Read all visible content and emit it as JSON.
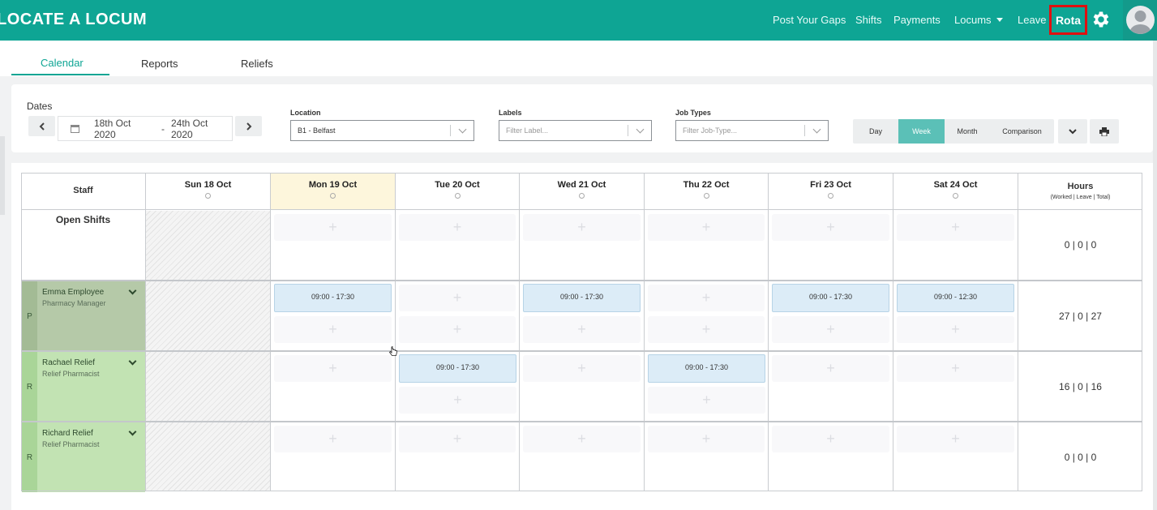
{
  "brand": "LOCATE A LOCUM",
  "nav": {
    "post_gaps": "Post Your Gaps",
    "shifts": "Shifts",
    "payments": "Payments",
    "locums": "Locums",
    "leave": "Leave",
    "rota": "Rota"
  },
  "tabs": [
    "Calendar",
    "Reports",
    "Reliefs"
  ],
  "filters": {
    "dates_label": "Dates",
    "date_start": "18th Oct 2020",
    "date_sep": "-",
    "date_end": "24th Oct 2020",
    "location_label": "Location",
    "location_value": "B1 - Belfast",
    "labels_label": "Labels",
    "labels_placeholder": "Filter Label...",
    "job_types_label": "Job Types",
    "job_types_placeholder": "Filter Job-Type..."
  },
  "views": [
    "Day",
    "Week",
    "Month",
    "Comparison"
  ],
  "active_view": "Week",
  "grid": {
    "staff_header": "Staff",
    "hours_header": "Hours",
    "hours_sub": "(Worked | Leave | Total)",
    "days": [
      "Sun 18 Oct",
      "Mon 19 Oct",
      "Tue 20 Oct",
      "Wed 21 Oct",
      "Thu 22 Oct",
      "Fri 23 Oct",
      "Sat 24 Oct"
    ],
    "open_shifts_label": "Open Shifts",
    "open_shifts_hours": "0 | 0 | 0",
    "staff": [
      {
        "tag": "P",
        "name": "Emma Employee",
        "role": "Pharmacy Manager",
        "hours": "27 | 0 | 27",
        "shifts": [
          "",
          "09:00 - 17:30",
          "",
          "09:00 - 17:30",
          "",
          "09:00 - 17:30",
          "09:00 - 12:30"
        ]
      },
      {
        "tag": "R",
        "name": "Rachael Relief",
        "role": "Relief Pharmacist",
        "hours": "16 | 0 | 16",
        "shifts": [
          "",
          "",
          "09:00 - 17:30",
          "",
          "09:00 - 17:30",
          "",
          ""
        ]
      },
      {
        "tag": "R",
        "name": "Richard Relief",
        "role": "Relief Pharmacist",
        "hours": "0 | 0 | 0",
        "shifts": [
          "",
          "",
          "",
          "",
          "",
          "",
          ""
        ]
      }
    ]
  },
  "colors": {
    "topbar": "#0ea594",
    "accent": "#5bc0b7",
    "manager_bg": "#b5c9a8",
    "relief_bg": "#c2e3b3",
    "shift_bg": "#dcecf7",
    "today_bg": "#fdf6dc"
  }
}
